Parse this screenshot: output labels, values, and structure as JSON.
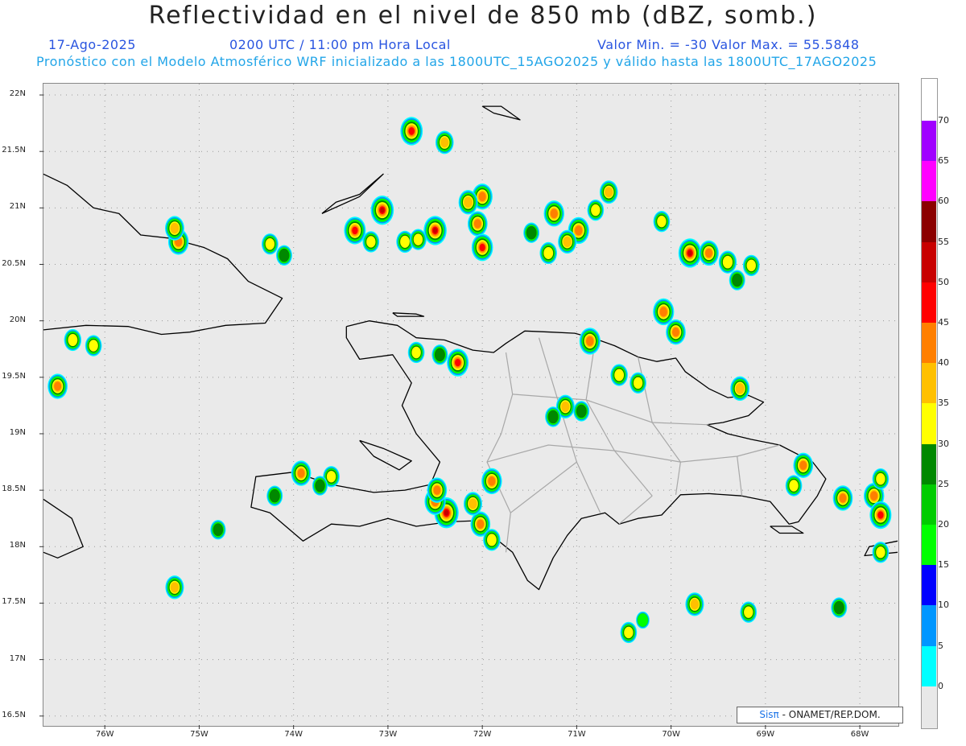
{
  "title": "Reflectividad en el nivel de 850 mb (dBZ, somb.)",
  "date": "17-Ago-2025",
  "time": "0200 UTC / 11:00 pm Hora Local",
  "min_max": "Valor Min. = -30  Valor Max. = 55.5848",
  "model_line": "Pronóstico con el Modelo Atmosférico WRF inicializado a las 1800UTC_15AGO2025 y válido hasta las  1800UTC_17AGO2025",
  "credit": {
    "logo": "Sisπ",
    "text": "- ONAMET/REP.DOM."
  },
  "map": {
    "lat_labels": [
      "22N",
      "21.5N",
      "21N",
      "20.5N",
      "20N",
      "19.5N",
      "19N",
      "18.5N",
      "18N",
      "17.5N",
      "17N",
      "16.5N"
    ],
    "lat_values": [
      22,
      21.5,
      21,
      20.5,
      20,
      19.5,
      19,
      18.5,
      18,
      17.5,
      17,
      16.5
    ],
    "lon_labels": [
      "76W",
      "75W",
      "74W",
      "73W",
      "72W",
      "71W",
      "70W",
      "69W",
      "68W"
    ],
    "lon_values": [
      -76,
      -75,
      -74,
      -73,
      -72,
      -71,
      -70,
      -69,
      -68
    ],
    "lon_range": [
      -76.65,
      -67.6
    ],
    "lat_range": [
      16.42,
      22.1
    ],
    "colorbar": {
      "labels": [
        "70",
        "65",
        "60",
        "55",
        "50",
        "45",
        "40",
        "35",
        "30",
        "25",
        "20",
        "15",
        "10",
        "5",
        "0"
      ],
      "colors": [
        "#a000ff",
        "#ff00ff",
        "#8b0000",
        "#c80000",
        "#ff0000",
        "#ff7f00",
        "#ffc000",
        "#ffff00",
        "#008800",
        "#00cc00",
        "#00ff00",
        "#0000ff",
        "#0096ff",
        "#00ffff"
      ]
    },
    "cells": [
      {
        "lon": -72.75,
        "lat": 21.68,
        "dbz": 48
      },
      {
        "lon": -72.4,
        "lat": 21.58,
        "dbz": 35
      },
      {
        "lon": -73.06,
        "lat": 20.98,
        "dbz": 50
      },
      {
        "lon": -72.0,
        "lat": 21.1,
        "dbz": 42
      },
      {
        "lon": -72.15,
        "lat": 21.05,
        "dbz": 38
      },
      {
        "lon": -73.35,
        "lat": 20.8,
        "dbz": 46
      },
      {
        "lon": -73.18,
        "lat": 20.7,
        "dbz": 30
      },
      {
        "lon": -72.5,
        "lat": 20.8,
        "dbz": 50
      },
      {
        "lon": -72.82,
        "lat": 20.7,
        "dbz": 32
      },
      {
        "lon": -72.68,
        "lat": 20.72,
        "dbz": 30
      },
      {
        "lon": -72.05,
        "lat": 20.86,
        "dbz": 40
      },
      {
        "lon": -72.0,
        "lat": 20.65,
        "dbz": 45
      },
      {
        "lon": -71.24,
        "lat": 20.95,
        "dbz": 42
      },
      {
        "lon": -70.98,
        "lat": 20.8,
        "dbz": 44
      },
      {
        "lon": -71.1,
        "lat": 20.7,
        "dbz": 36
      },
      {
        "lon": -70.8,
        "lat": 20.98,
        "dbz": 30
      },
      {
        "lon": -70.66,
        "lat": 21.14,
        "dbz": 35
      },
      {
        "lon": -71.3,
        "lat": 20.6,
        "dbz": 32
      },
      {
        "lon": -71.48,
        "lat": 20.78,
        "dbz": 28
      },
      {
        "lon": -70.1,
        "lat": 20.88,
        "dbz": 30
      },
      {
        "lon": -69.8,
        "lat": 20.6,
        "dbz": 50
      },
      {
        "lon": -69.6,
        "lat": 20.6,
        "dbz": 40
      },
      {
        "lon": -69.4,
        "lat": 20.52,
        "dbz": 34
      },
      {
        "lon": -69.15,
        "lat": 20.49,
        "dbz": 30
      },
      {
        "lon": -69.3,
        "lat": 20.36,
        "dbz": 28
      },
      {
        "lon": -70.08,
        "lat": 20.08,
        "dbz": 44
      },
      {
        "lon": -69.95,
        "lat": 19.9,
        "dbz": 40
      },
      {
        "lon": -75.22,
        "lat": 20.7,
        "dbz": 42
      },
      {
        "lon": -75.26,
        "lat": 20.82,
        "dbz": 38
      },
      {
        "lon": -74.25,
        "lat": 20.68,
        "dbz": 30
      },
      {
        "lon": -74.1,
        "lat": 20.58,
        "dbz": 28
      },
      {
        "lon": -76.34,
        "lat": 19.83,
        "dbz": 32
      },
      {
        "lon": -76.12,
        "lat": 19.78,
        "dbz": 30
      },
      {
        "lon": -76.5,
        "lat": 19.42,
        "dbz": 40
      },
      {
        "lon": -72.26,
        "lat": 19.63,
        "dbz": 46
      },
      {
        "lon": -72.45,
        "lat": 19.7,
        "dbz": 28
      },
      {
        "lon": -72.7,
        "lat": 19.72,
        "dbz": 30
      },
      {
        "lon": -70.86,
        "lat": 19.82,
        "dbz": 44
      },
      {
        "lon": -70.55,
        "lat": 19.52,
        "dbz": 32
      },
      {
        "lon": -70.35,
        "lat": 19.45,
        "dbz": 30
      },
      {
        "lon": -71.12,
        "lat": 19.24,
        "dbz": 36
      },
      {
        "lon": -70.95,
        "lat": 19.2,
        "dbz": 28
      },
      {
        "lon": -71.25,
        "lat": 19.15,
        "dbz": 28
      },
      {
        "lon": -69.27,
        "lat": 19.4,
        "dbz": 38
      },
      {
        "lon": -72.38,
        "lat": 18.3,
        "dbz": 54
      },
      {
        "lon": -72.5,
        "lat": 18.4,
        "dbz": 44
      },
      {
        "lon": -72.02,
        "lat": 18.2,
        "dbz": 40
      },
      {
        "lon": -72.1,
        "lat": 18.38,
        "dbz": 36
      },
      {
        "lon": -71.9,
        "lat": 18.58,
        "dbz": 42
      },
      {
        "lon": -72.48,
        "lat": 18.5,
        "dbz": 40
      },
      {
        "lon": -71.9,
        "lat": 18.06,
        "dbz": 32
      },
      {
        "lon": -73.92,
        "lat": 18.65,
        "dbz": 40
      },
      {
        "lon": -73.6,
        "lat": 18.62,
        "dbz": 30
      },
      {
        "lon": -74.2,
        "lat": 18.45,
        "dbz": 28
      },
      {
        "lon": -73.72,
        "lat": 18.54,
        "dbz": 26
      },
      {
        "lon": -74.8,
        "lat": 18.15,
        "dbz": 26
      },
      {
        "lon": -75.26,
        "lat": 17.64,
        "dbz": 36
      },
      {
        "lon": -68.6,
        "lat": 18.72,
        "dbz": 40
      },
      {
        "lon": -68.7,
        "lat": 18.54,
        "dbz": 30
      },
      {
        "lon": -68.18,
        "lat": 18.43,
        "dbz": 40
      },
      {
        "lon": -67.85,
        "lat": 18.45,
        "dbz": 42
      },
      {
        "lon": -67.78,
        "lat": 18.28,
        "dbz": 46
      },
      {
        "lon": -67.78,
        "lat": 18.6,
        "dbz": 30
      },
      {
        "lon": -67.78,
        "lat": 17.95,
        "dbz": 30
      },
      {
        "lon": -69.75,
        "lat": 17.49,
        "dbz": 36
      },
      {
        "lon": -69.18,
        "lat": 17.42,
        "dbz": 30
      },
      {
        "lon": -68.22,
        "lat": 17.46,
        "dbz": 28
      },
      {
        "lon": -70.45,
        "lat": 17.24,
        "dbz": 30
      },
      {
        "lon": -70.3,
        "lat": 17.35,
        "dbz": 20
      }
    ],
    "coast_hispaniola": [
      [
        -73.44,
        19.95
      ],
      [
        -73.2,
        20.0
      ],
      [
        -72.9,
        19.96
      ],
      [
        -72.7,
        19.85
      ],
      [
        -72.4,
        19.83
      ],
      [
        -72.1,
        19.74
      ],
      [
        -71.88,
        19.72
      ],
      [
        -71.75,
        19.8
      ],
      [
        -71.55,
        19.91
      ],
      [
        -71.27,
        19.9
      ],
      [
        -71.02,
        19.89
      ],
      [
        -70.8,
        19.84
      ],
      [
        -70.6,
        19.78
      ],
      [
        -70.35,
        19.68
      ],
      [
        -70.15,
        19.64
      ],
      [
        -69.95,
        19.67
      ],
      [
        -69.85,
        19.55
      ],
      [
        -69.6,
        19.4
      ],
      [
        -69.4,
        19.32
      ],
      [
        -69.18,
        19.34
      ],
      [
        -69.02,
        19.28
      ],
      [
        -69.18,
        19.16
      ],
      [
        -69.45,
        19.1
      ],
      [
        -69.62,
        19.08
      ],
      [
        -69.4,
        19.0
      ],
      [
        -69.15,
        18.95
      ],
      [
        -68.85,
        18.9
      ],
      [
        -68.5,
        18.75
      ],
      [
        -68.36,
        18.6
      ],
      [
        -68.45,
        18.45
      ],
      [
        -68.65,
        18.22
      ],
      [
        -68.75,
        18.2
      ],
      [
        -68.95,
        18.4
      ],
      [
        -69.25,
        18.45
      ],
      [
        -69.6,
        18.47
      ],
      [
        -69.9,
        18.46
      ],
      [
        -70.1,
        18.28
      ],
      [
        -70.35,
        18.25
      ],
      [
        -70.55,
        18.2
      ],
      [
        -70.7,
        18.3
      ],
      [
        -70.95,
        18.25
      ],
      [
        -71.1,
        18.1
      ],
      [
        -71.25,
        17.9
      ],
      [
        -71.4,
        17.62
      ],
      [
        -71.52,
        17.7
      ],
      [
        -71.68,
        17.95
      ],
      [
        -71.9,
        18.1
      ],
      [
        -72.05,
        18.23
      ],
      [
        -72.35,
        18.22
      ],
      [
        -72.7,
        18.18
      ],
      [
        -73.0,
        18.25
      ],
      [
        -73.3,
        18.18
      ],
      [
        -73.6,
        18.2
      ],
      [
        -73.9,
        18.05
      ],
      [
        -74.25,
        18.3
      ],
      [
        -74.45,
        18.35
      ],
      [
        -74.4,
        18.62
      ],
      [
        -74.0,
        18.66
      ],
      [
        -73.6,
        18.55
      ],
      [
        -73.15,
        18.48
      ],
      [
        -72.82,
        18.5
      ],
      [
        -72.55,
        18.55
      ],
      [
        -72.45,
        18.75
      ],
      [
        -72.7,
        19.0
      ],
      [
        -72.85,
        19.25
      ],
      [
        -72.75,
        19.45
      ],
      [
        -72.95,
        19.7
      ],
      [
        -73.3,
        19.66
      ],
      [
        -73.44,
        19.85
      ],
      [
        -73.44,
        19.95
      ]
    ],
    "coast_cuba": [
      [
        -76.65,
        19.92
      ],
      [
        -76.2,
        19.96
      ],
      [
        -75.75,
        19.95
      ],
      [
        -75.4,
        19.88
      ],
      [
        -75.1,
        19.9
      ],
      [
        -74.72,
        19.96
      ],
      [
        -74.3,
        19.98
      ],
      [
        -74.12,
        20.2
      ],
      [
        -74.48,
        20.35
      ],
      [
        -74.7,
        20.55
      ],
      [
        -74.95,
        20.65
      ],
      [
        -75.3,
        20.73
      ],
      [
        -75.62,
        20.76
      ],
      [
        -75.85,
        20.95
      ],
      [
        -76.12,
        21.0
      ],
      [
        -76.4,
        21.2
      ],
      [
        -76.65,
        21.3
      ]
    ],
    "coast_gonave": [
      [
        -73.3,
        18.94
      ],
      [
        -73.05,
        18.87
      ],
      [
        -72.75,
        18.76
      ],
      [
        -72.88,
        18.68
      ],
      [
        -73.15,
        18.8
      ],
      [
        -73.3,
        18.94
      ]
    ],
    "coast_tortue": [
      [
        -72.95,
        20.07
      ],
      [
        -72.7,
        20.06
      ],
      [
        -72.62,
        20.04
      ],
      [
        -72.9,
        20.04
      ],
      [
        -72.95,
        20.07
      ]
    ],
    "coast_inagua": [
      [
        -73.7,
        20.95
      ],
      [
        -73.3,
        21.1
      ],
      [
        -73.05,
        21.3
      ],
      [
        -73.3,
        21.12
      ],
      [
        -73.55,
        21.05
      ],
      [
        -73.7,
        20.95
      ]
    ],
    "coast_caicos": [
      [
        -72.0,
        21.9
      ],
      [
        -71.8,
        21.9
      ],
      [
        -71.6,
        21.78
      ],
      [
        -71.88,
        21.84
      ],
      [
        -72.0,
        21.9
      ]
    ],
    "coast_jamaica": [
      [
        -76.65,
        18.42
      ],
      [
        -76.35,
        18.25
      ],
      [
        -76.23,
        18.0
      ],
      [
        -76.5,
        17.9
      ],
      [
        -76.65,
        17.95
      ]
    ],
    "coast_saona": [
      [
        -68.95,
        18.18
      ],
      [
        -68.72,
        18.18
      ],
      [
        -68.6,
        18.12
      ],
      [
        -68.85,
        18.12
      ],
      [
        -68.95,
        18.18
      ]
    ],
    "coast_pr": [
      [
        -67.6,
        18.05
      ],
      [
        -67.9,
        18.0
      ],
      [
        -67.95,
        17.92
      ],
      [
        -67.6,
        17.95
      ]
    ],
    "borders": [
      [
        [
          -71.75,
          19.72
        ],
        [
          -71.68,
          19.35
        ],
        [
          -71.8,
          19.0
        ],
        [
          -71.95,
          18.75
        ],
        [
          -71.7,
          18.3
        ],
        [
          -71.75,
          17.95
        ]
      ],
      [
        [
          -71.4,
          19.85
        ],
        [
          -71.2,
          19.3
        ],
        [
          -71.0,
          18.75
        ],
        [
          -70.75,
          18.3
        ]
      ],
      [
        [
          -70.8,
          19.84
        ],
        [
          -70.9,
          19.3
        ],
        [
          -70.6,
          18.85
        ],
        [
          -70.2,
          18.45
        ]
      ],
      [
        [
          -70.35,
          19.68
        ],
        [
          -70.2,
          19.1
        ],
        [
          -69.9,
          18.75
        ],
        [
          -69.95,
          18.46
        ]
      ],
      [
        [
          -71.68,
          19.35
        ],
        [
          -70.9,
          19.3
        ],
        [
          -70.2,
          19.1
        ],
        [
          -69.6,
          19.08
        ]
      ],
      [
        [
          -71.95,
          18.75
        ],
        [
          -71.3,
          18.9
        ],
        [
          -70.6,
          18.85
        ],
        [
          -69.9,
          18.75
        ],
        [
          -69.3,
          18.8
        ],
        [
          -68.85,
          18.9
        ]
      ],
      [
        [
          -71.7,
          18.3
        ],
        [
          -71.0,
          18.75
        ]
      ],
      [
        [
          -69.3,
          18.8
        ],
        [
          -69.25,
          18.45
        ]
      ],
      [
        [
          -70.55,
          18.2
        ],
        [
          -70.2,
          18.45
        ]
      ]
    ]
  }
}
